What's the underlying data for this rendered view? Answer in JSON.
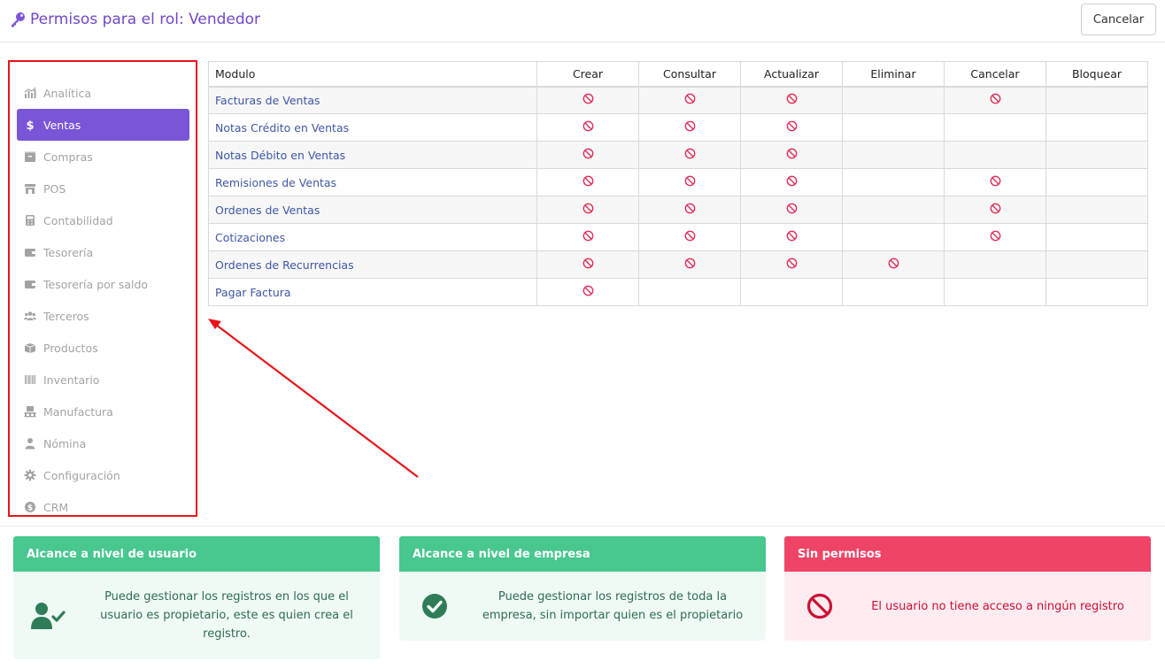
{
  "header": {
    "title": "Permisos para el rol: Vendedor",
    "cancel_label": "Cancelar"
  },
  "sidebar": {
    "items": [
      {
        "label": "Analítica",
        "icon": "chart-icon"
      },
      {
        "label": "Ventas",
        "icon": "dollar-icon",
        "active": true
      },
      {
        "label": "Compras",
        "icon": "box-icon"
      },
      {
        "label": "POS",
        "icon": "store-icon"
      },
      {
        "label": "Contabilidad",
        "icon": "calculator-icon"
      },
      {
        "label": "Tesorería",
        "icon": "wallet-icon"
      },
      {
        "label": "Tesorería por saldo",
        "icon": "wallet-icon"
      },
      {
        "label": "Terceros",
        "icon": "users-icon"
      },
      {
        "label": "Productos",
        "icon": "boxes-icon"
      },
      {
        "label": "Inventario",
        "icon": "barcode-icon"
      },
      {
        "label": "Manufactura",
        "icon": "pallet-icon"
      },
      {
        "label": "Nómina",
        "icon": "user-icon"
      },
      {
        "label": "Configuración",
        "icon": "gear-icon"
      },
      {
        "label": "CRM",
        "icon": "coin-icon"
      }
    ]
  },
  "table": {
    "headers": [
      "Modulo",
      "Crear",
      "Consultar",
      "Actualizar",
      "Eliminar",
      "Cancelar",
      "Bloquear"
    ],
    "rows": [
      {
        "module": "Facturas de Ventas",
        "perms": [
          true,
          true,
          true,
          false,
          true,
          false
        ]
      },
      {
        "module": "Notas Crédito en Ventas",
        "perms": [
          true,
          true,
          true,
          false,
          false,
          false
        ]
      },
      {
        "module": "Notas Débito en Ventas",
        "perms": [
          true,
          true,
          true,
          false,
          false,
          false
        ]
      },
      {
        "module": "Remisiones de Ventas",
        "perms": [
          true,
          true,
          true,
          false,
          true,
          false
        ]
      },
      {
        "module": "Ordenes de Ventas",
        "perms": [
          true,
          true,
          true,
          false,
          true,
          false
        ]
      },
      {
        "module": "Cotizaciones",
        "perms": [
          true,
          true,
          true,
          false,
          true,
          false
        ]
      },
      {
        "module": "Ordenes de Recurrencias",
        "perms": [
          true,
          true,
          true,
          true,
          false,
          false
        ]
      },
      {
        "module": "Pagar Factura",
        "perms": [
          true,
          false,
          false,
          false,
          false,
          false
        ]
      }
    ],
    "perm_icon": "ban-icon"
  },
  "legend": {
    "user_scope": {
      "title": "Alcance a nivel de usuario",
      "text": "Puede gestionar los registros en los que el usuario es propietario, este es quien crea el registro.",
      "icon": "user-check-icon"
    },
    "company_scope": {
      "title": "Alcance a nivel de empresa",
      "text": "Puede gestionar los registros de toda la empresa, sin importar quien es el propietario",
      "icon": "check-circle-icon"
    },
    "no_perm": {
      "title": "Sin permisos",
      "text": "El usuario no tiene acceso a ningún registro",
      "icon": "ban-icon"
    }
  },
  "colors": {
    "accent": "#7a55d8",
    "green": "#48c78e",
    "red": "#f04467",
    "annotation": "#e8141a"
  }
}
